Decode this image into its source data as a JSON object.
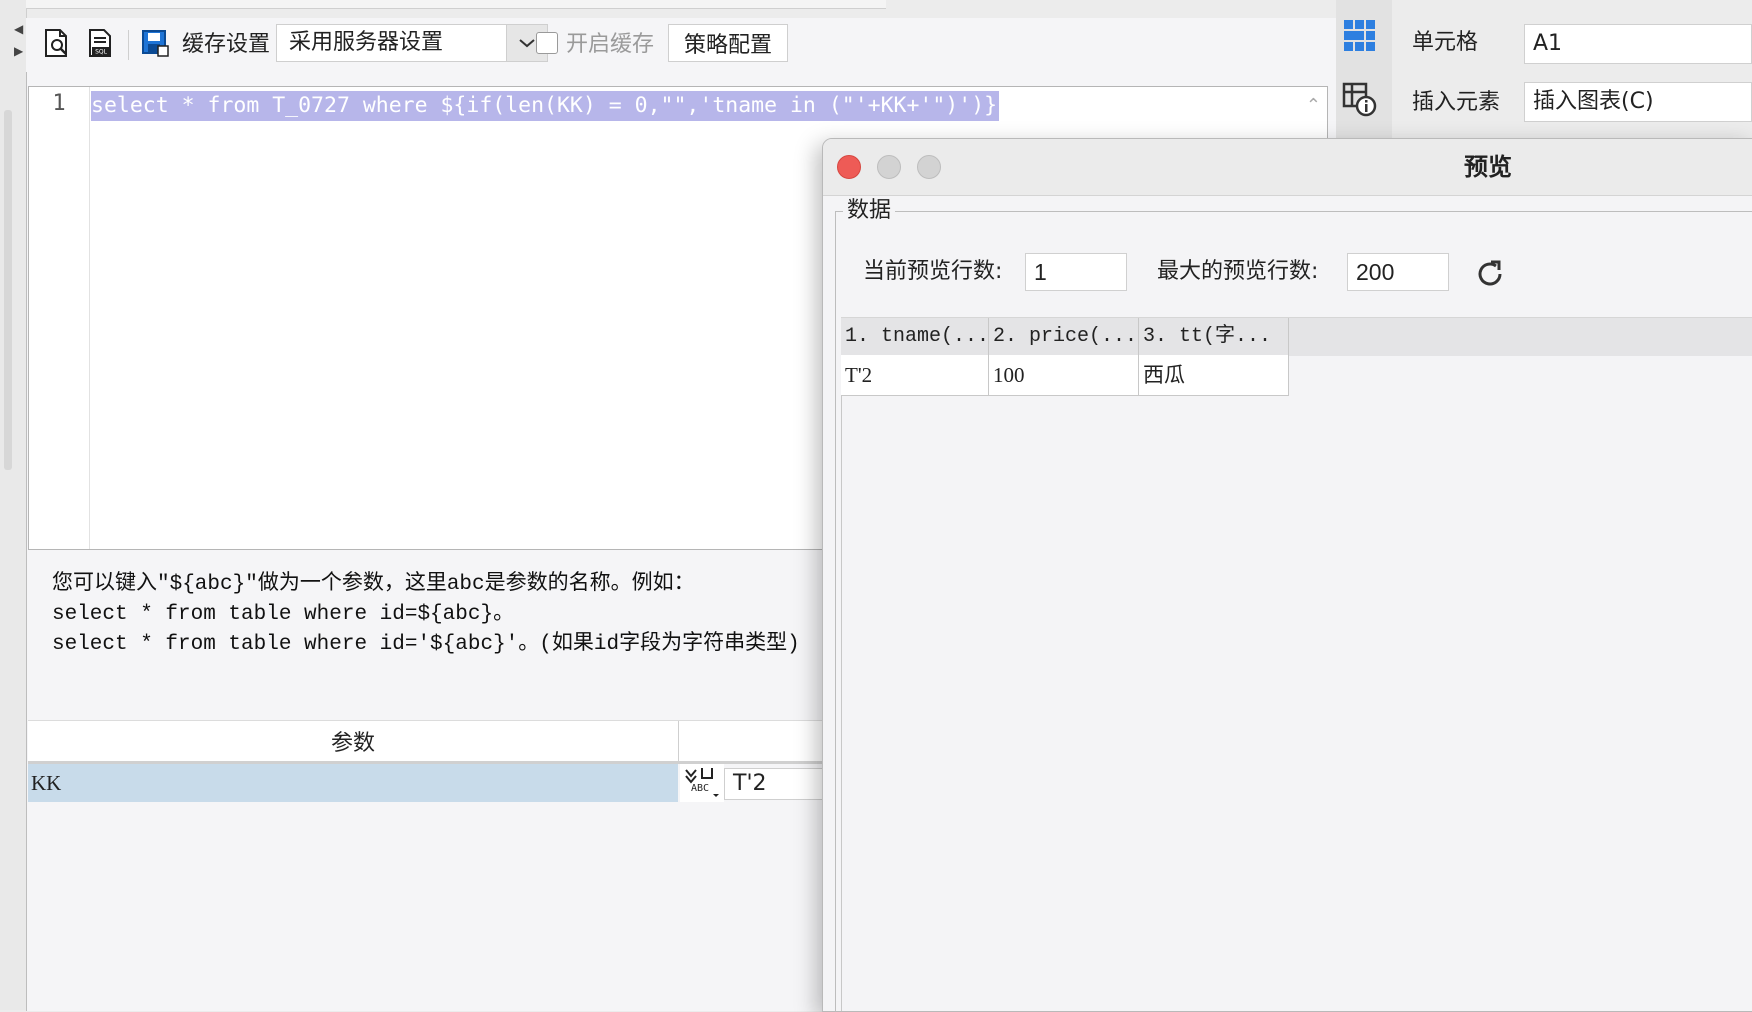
{
  "toolbar": {
    "cache_settings_label": "缓存设置",
    "cache_mode_value": "采用服务器设置",
    "enable_cache_label": "开启缓存",
    "strategy_button_label": "策略配置"
  },
  "editor": {
    "line_number": "1",
    "sql_text": "select * from T_0727 where ${if(len(KK) = 0,\"\",'tname in (\"'+KK+'\")')}"
  },
  "hint": {
    "line1": "您可以键入\"${abc}\"做为一个参数，这里abc是参数的名称。例如：",
    "line2": "select * from table where id=${abc}。",
    "line3": "select * from table where id='${abc}'。(如果id字段为字符串类型)"
  },
  "params": {
    "header": "参数",
    "rows": [
      {
        "name": "KK",
        "value": "T'2"
      }
    ]
  },
  "right_panel": {
    "cell_label": "单元格",
    "cell_value": "A1",
    "insert_label": "插入元素",
    "insert_value": "插入图表(C)"
  },
  "preview": {
    "title": "预览",
    "group_title": "数据",
    "current_rows_label": "当前预览行数:",
    "current_rows_value": "1",
    "max_rows_label": "最大的预览行数:",
    "max_rows_value": "200",
    "columns": [
      "1. tname(...",
      "2. price(...",
      "3. tt(字..."
    ],
    "rows": [
      [
        "T'2",
        "100",
        "西瓜"
      ]
    ]
  },
  "colors": {
    "selection": "#b7b6ea",
    "param_row": "#c8dbea",
    "close_button": "#ee5b56",
    "accent_blue": "#1e74d6"
  }
}
